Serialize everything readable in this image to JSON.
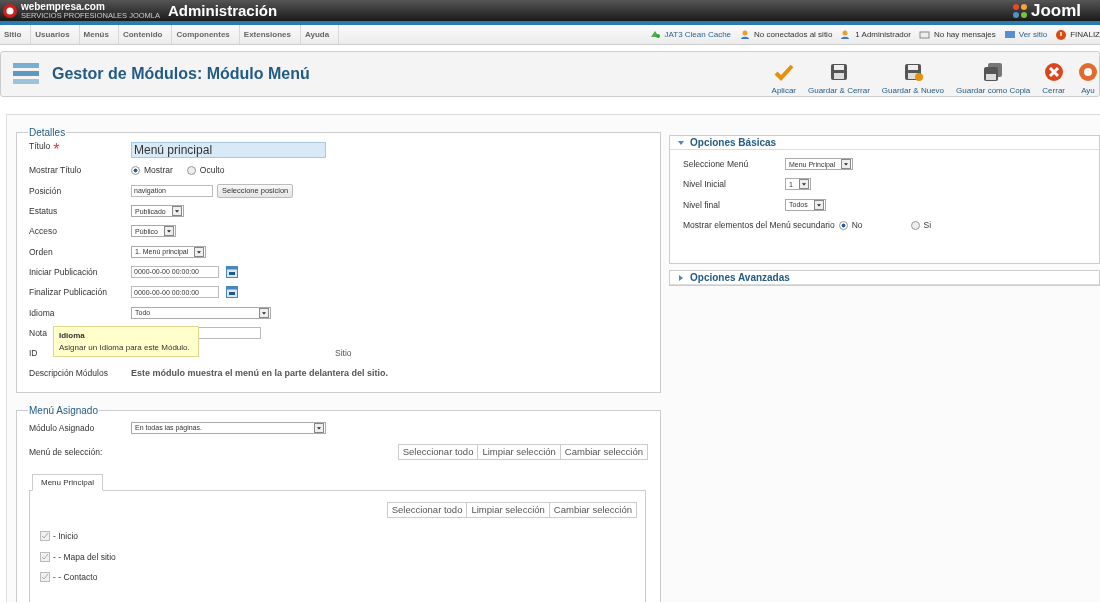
{
  "header": {
    "brand": "webempresa.com",
    "tagline": "SERVICIOS PROFESIONALES JOOMLA",
    "title": "Administración",
    "cms_logo": "Jooml"
  },
  "menu": [
    {
      "label": "Sitio"
    },
    {
      "label": "Usuarios"
    },
    {
      "label": "Menús"
    },
    {
      "label": "Contenido"
    },
    {
      "label": "Componentes"
    },
    {
      "label": "Extensiones"
    },
    {
      "label": "Ayuda"
    }
  ],
  "status": [
    {
      "kind": "cache",
      "label": "JAT3 Clean Cache"
    },
    {
      "kind": "users",
      "label": "No conectados al sitio"
    },
    {
      "kind": "admin",
      "label": "1 Administrador"
    },
    {
      "kind": "mail",
      "label": "No hay mensajes"
    },
    {
      "kind": "site",
      "label": "Ver sitio"
    },
    {
      "kind": "logout",
      "label": "FINALIZ"
    }
  ],
  "page_title": "Gestor de Módulos: Módulo Menú",
  "toolbar": [
    {
      "kind": "apply",
      "label": "Aplicar"
    },
    {
      "kind": "save",
      "label": "Guardar & Cerrar"
    },
    {
      "kind": "save_new",
      "label": "Guardar & Nuevo"
    },
    {
      "kind": "copy",
      "label": "Guardar como Copia"
    },
    {
      "kind": "close",
      "label": "Cerrar"
    },
    {
      "kind": "help",
      "label": "Ayu"
    }
  ],
  "details": {
    "legend": "Detalles",
    "fields": [
      {
        "kind": "text",
        "label": "Título",
        "required_mark": "*",
        "value": "Menú principal",
        "focused": true
      },
      {
        "kind": "radio",
        "label": "Mostrar Título",
        "options": [
          {
            "label": "Mostrar",
            "selected": true
          },
          {
            "label": "Oculto",
            "selected": false
          }
        ]
      },
      {
        "kind": "text_button",
        "label": "Posición",
        "value": "navigation",
        "button": "Seleccione posicion"
      },
      {
        "kind": "select",
        "label": "Estatus",
        "value": "Publicado"
      },
      {
        "kind": "select",
        "label": "Acceso",
        "value": "Público"
      },
      {
        "kind": "select",
        "label": "Orden",
        "value": "1. Menú principal"
      },
      {
        "kind": "date",
        "label": "Iniciar Publicación",
        "value": "0000-00-00 00:00:00"
      },
      {
        "kind": "date",
        "label": "Finalizar Publicación",
        "value": "0000-00-00 00:00:00"
      },
      {
        "kind": "wide_select",
        "label": "Idioma",
        "value": "Todo"
      },
      {
        "kind": "text",
        "label": "Nota",
        "focused": false
      },
      {
        "kind": "offset_static",
        "label": "ID",
        "value": "Sitio"
      },
      {
        "kind": "static",
        "label": "Descripción Módulos",
        "value": "Este módulo muestra el menú en la parte delantera del sitio."
      }
    ],
    "tooltip": {
      "title": "Idioma",
      "text": "Asignar un Idioma para este Módulo."
    }
  },
  "options": [
    {
      "title": "Opciones Básicas",
      "expanded": true,
      "fields": [
        {
          "kind": "select",
          "label": "Seleccione Menú",
          "value": "Menu Principal"
        },
        {
          "kind": "select",
          "label": "Nivel Inicial",
          "value": "1"
        },
        {
          "kind": "select",
          "label": "Nivel final",
          "value": "Todos"
        },
        {
          "kind": "radio",
          "label": "Mostrar elementos del Menú secundario",
          "options": [
            {
              "label": "No",
              "selected": true
            },
            {
              "label": "Si",
              "selected": false
            }
          ]
        }
      ]
    },
    {
      "title": "Opciones Avanzadas",
      "expanded": false
    }
  ],
  "assignment": {
    "legend": "Menú Asignado",
    "label": "Módulo Asignado",
    "value": "En todas las páginas.",
    "selection_label": "Menú de selección:",
    "buttons": [
      "Seleccionar todo",
      "Limpiar selección",
      "Cambiar selección"
    ],
    "tabs": [
      {
        "label": "Menu Principal",
        "selected": true
      }
    ],
    "inner_buttons": [
      "Seleccionar todo",
      "Limpiar selección",
      "Cambiar selección"
    ],
    "items": [
      {
        "label": "- Inicio",
        "checked": true,
        "disabled": true,
        "children": [
          {
            "label": "- - Mapa del sitio",
            "checked": true,
            "disabled": true
          },
          {
            "label": "- - Contacto",
            "checked": true,
            "disabled": true
          }
        ]
      }
    ]
  }
}
